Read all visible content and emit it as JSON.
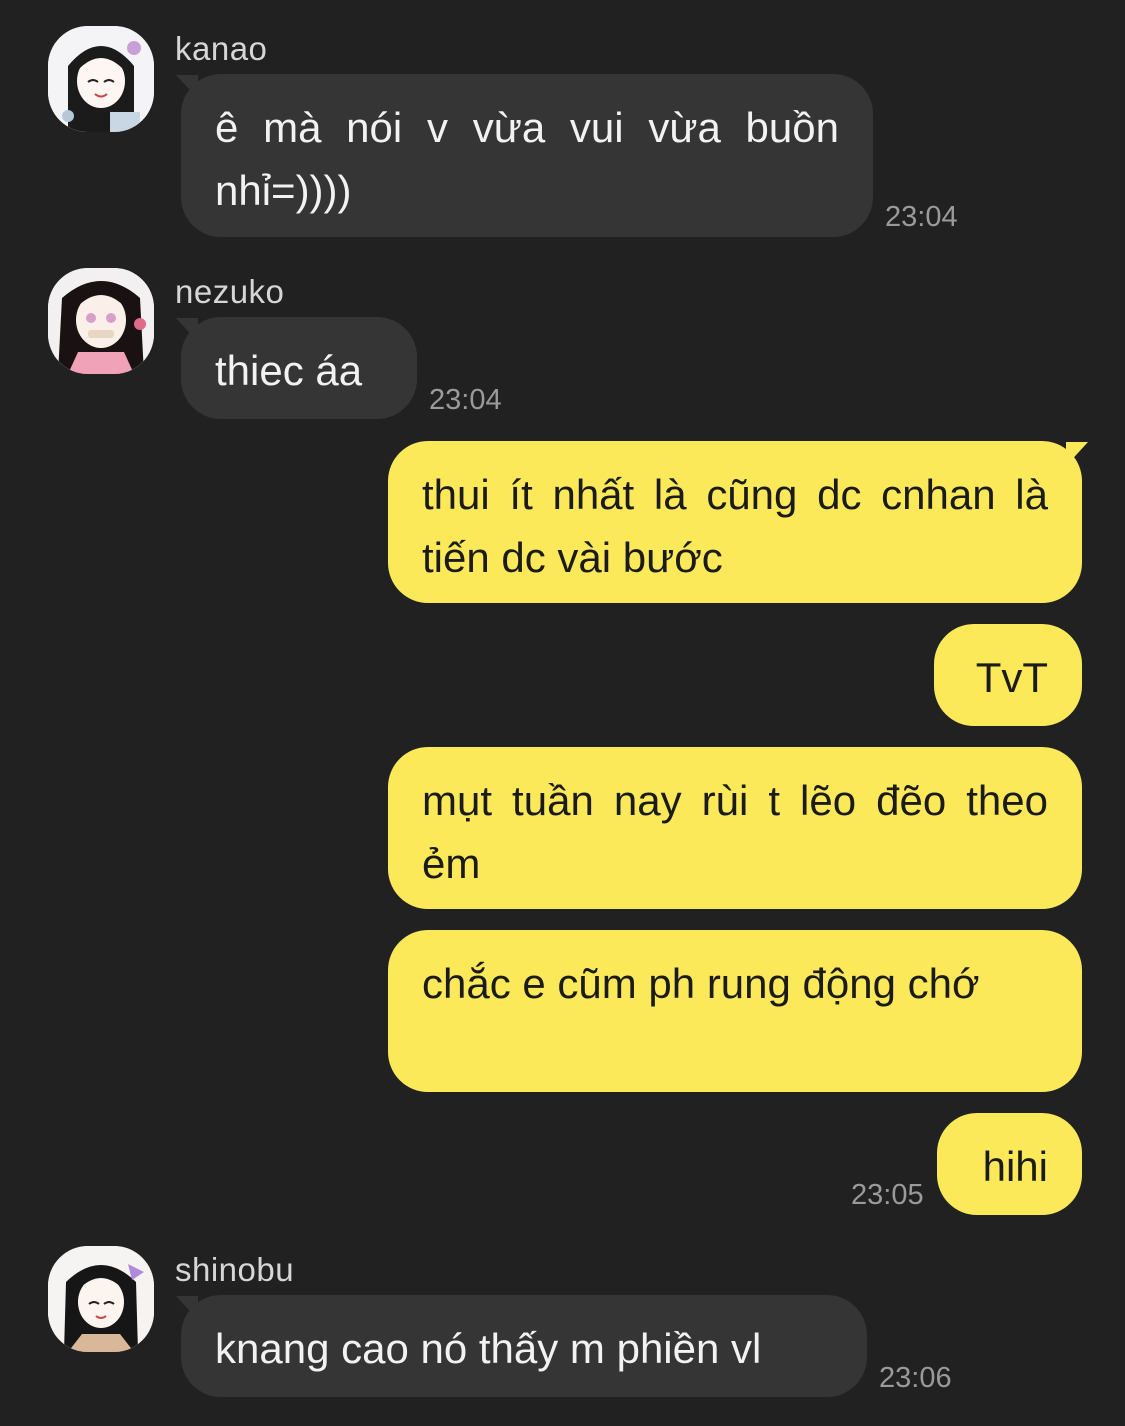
{
  "messages": [
    {
      "sender": "kanao",
      "direction": "incoming",
      "text": "ê mà nói v vừa vui vừa buồn nhỉ=))))",
      "time": "23:04"
    },
    {
      "sender": "nezuko",
      "direction": "incoming",
      "text": "thiec áa",
      "time": "23:04"
    },
    {
      "direction": "outgoing",
      "text": "thui ít nhất là cũng dc cnhan là tiến dc vài bước"
    },
    {
      "direction": "outgoing",
      "text": "TvT"
    },
    {
      "direction": "outgoing",
      "text": "mụt tuần nay rùi t lẽo đẽo theo ẻm"
    },
    {
      "direction": "outgoing",
      "text": "chắc e cũm ph rung động chớ"
    },
    {
      "direction": "outgoing",
      "text": "hihi",
      "time": "23:05"
    },
    {
      "sender": "shinobu",
      "direction": "incoming",
      "text": "knang cao nó thấy m phiền vl",
      "time": "23:06"
    }
  ],
  "colors": {
    "background": "#212121",
    "incoming_bubble": "#353535",
    "outgoing_bubble": "#fbe959",
    "timestamp": "#9a9a9a"
  }
}
